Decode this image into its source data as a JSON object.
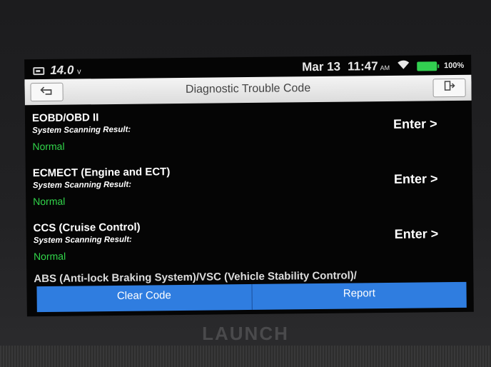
{
  "status_bar": {
    "voltage": "14.0",
    "voltage_unit": "v",
    "date": "Mar 13",
    "time": "11:47",
    "ampm": "AM",
    "battery_pct": "100%",
    "icons": [
      "battery-icon",
      "wifi-icon",
      "battery-level-icon"
    ]
  },
  "header": {
    "title": "Diagnostic Trouble Code",
    "back_icon": "back-arrow-icon",
    "exit_icon": "exit-icon"
  },
  "systems": [
    {
      "name": "EOBD/OBD II",
      "result_label": "System Scanning Result:",
      "status": "Normal",
      "action": "Enter >"
    },
    {
      "name": "ECMECT (Engine and ECT)",
      "result_label": "System Scanning Result:",
      "status": "Normal",
      "action": "Enter >"
    },
    {
      "name": "CCS (Cruise Control)",
      "result_label": "System Scanning Result:",
      "status": "Normal",
      "action": "Enter >"
    },
    {
      "name": "ABS (Anti-lock Braking System)/VSC (Vehicle Stability Control)/"
    }
  ],
  "footer": {
    "clear_label": "Clear Code",
    "report_label": "Report"
  },
  "device": {
    "brand": "LAUNCH"
  },
  "colors": {
    "status_normal": "#31d54a",
    "action_bar": "#2f7de0",
    "battery": "#32d050"
  }
}
